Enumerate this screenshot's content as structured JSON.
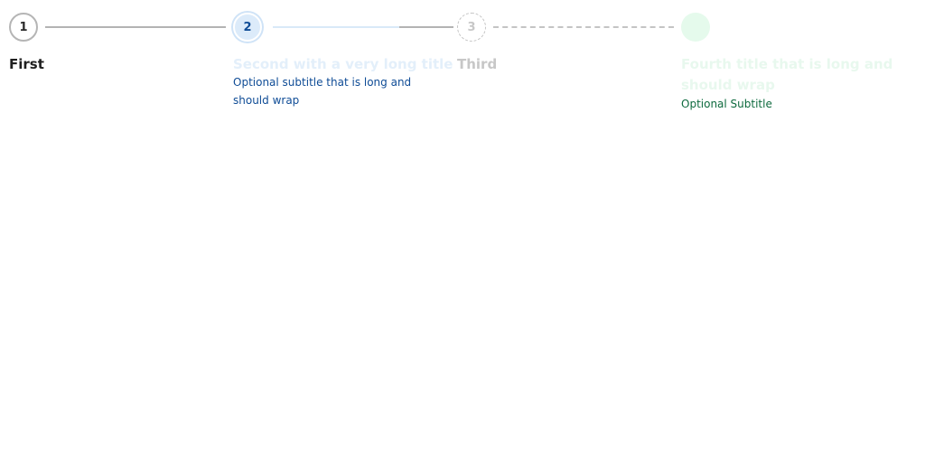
{
  "steps": [
    {
      "number": "1",
      "title": "First",
      "subtitle": "",
      "state": "completed"
    },
    {
      "number": "2",
      "title": "Second with a very long title",
      "subtitle": "Optional subtitle that is long and should wrap",
      "state": "active"
    },
    {
      "number": "3",
      "title": "Third",
      "subtitle": "",
      "state": "disabled"
    },
    {
      "number": "",
      "title": "Fourth title that is long and should wrap",
      "subtitle": "Optional Subtitle",
      "state": "success"
    }
  ],
  "colors": {
    "completed_border": "#b5b5b5",
    "active_fill": "#dcebfa",
    "active_text": "#0f4c96",
    "disabled": "#c7c7c7",
    "success_fill": "#e5faec",
    "success_text": "#0f6b3f"
  }
}
